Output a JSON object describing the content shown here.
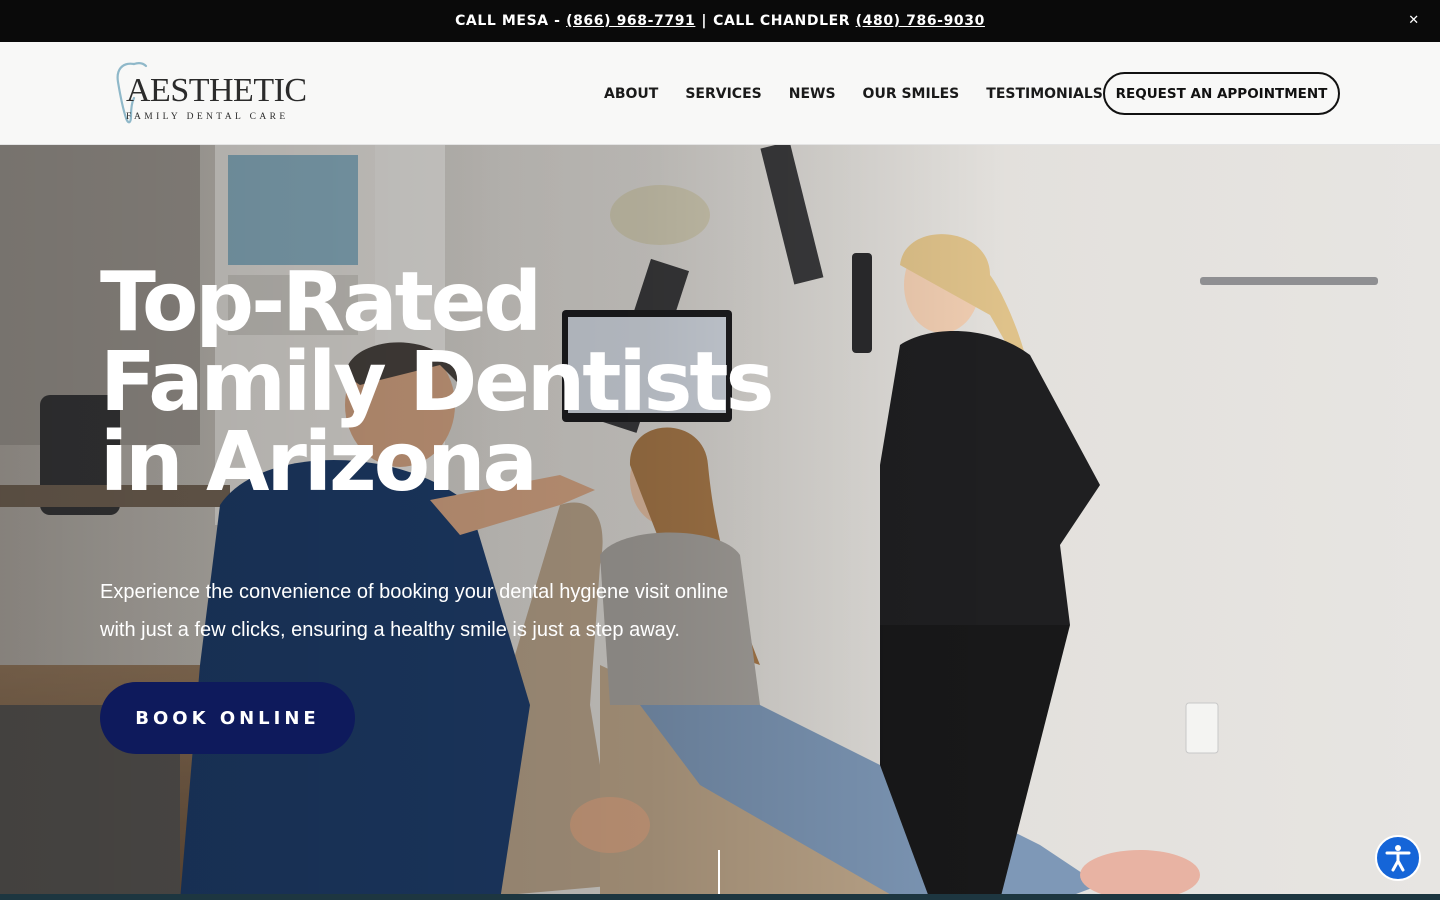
{
  "announcement": {
    "mesa_prefix": "CALL MESA -",
    "mesa_phone": "(866) 968-7791",
    "separator": "|",
    "chandler_prefix": "CALL CHANDLER",
    "chandler_phone": "(480) 786-9030",
    "close_label": "✕"
  },
  "header": {
    "logo": {
      "wordmark": "AESTHETIC",
      "tagline": "FAMILY DENTAL CARE"
    },
    "nav": [
      "ABOUT",
      "SERVICES",
      "NEWS",
      "OUR SMILES",
      "TESTIMONIALS"
    ],
    "cta_label": "REQUEST AN APPOINTMENT"
  },
  "hero": {
    "title_lines": [
      "Top-Rated",
      "Family Dentists",
      "in Arizona"
    ],
    "subtitle_lines": [
      "Experience the convenience of booking your dental hygiene visit online",
      "with just a few clicks, ensuring a healthy smile is just a step away."
    ],
    "button_label": "BOOK ONLINE"
  },
  "accessibility": {
    "icon": "accessibility-icon"
  },
  "colors": {
    "announcement_bg": "#0a0a0a",
    "header_bg": "#f8f8f7",
    "book_button_bg": "#0e1a5c",
    "accessibility_bg": "#1565d8"
  }
}
